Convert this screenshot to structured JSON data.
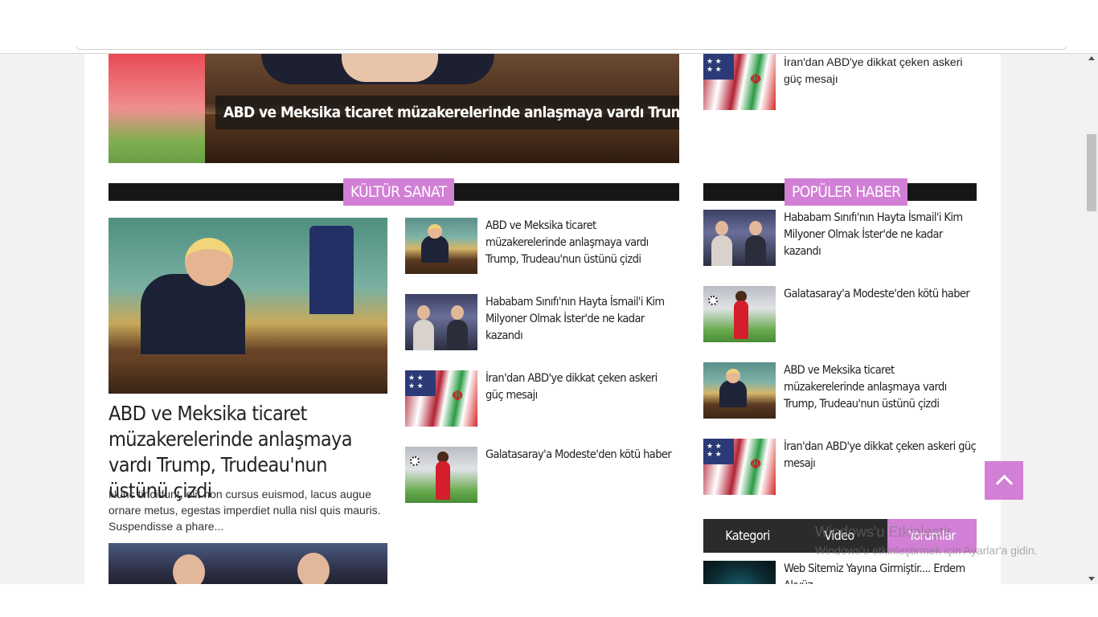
{
  "slider": {
    "caption": "ABD ve Meksika ticaret müzakerelerinde anlaşmaya vardı Trump, Trudeau'nun üstünü çizdi"
  },
  "right_top": {
    "title": "İran'dan ABD'ye dikkat çeken askeri güç mesajı"
  },
  "kultur": {
    "label": "KÜLTÜR SANAT",
    "featured": {
      "title": "ABD ve Meksika ticaret müzakerelerinde anlaşmaya vardı Trump, Trudeau'nun üstünü çizdi",
      "desc": "Nunc tincidunt, elit non cursus euismod, lacus augue ornare metus, egestas imperdiet nulla nisl quis mauris. Suspendisse a phare..."
    },
    "items": [
      {
        "title": "ABD ve Meksika ticaret müzakerelerinde anlaşmaya vardı Trump, Trudeau'nun üstünü çizdi"
      },
      {
        "title": "Hababam Sınıfı'nın Hayta İsmail'i Kim Milyoner Olmak İster'de ne kadar kazandı"
      },
      {
        "title": "İran'dan ABD'ye dikkat çeken askeri güç mesajı"
      },
      {
        "title": "Galatasaray'a Modeste'den kötü haber"
      }
    ]
  },
  "populer": {
    "label": "POPÜLER HABER",
    "items": [
      {
        "title": "Hababam Sınıfı'nın Hayta İsmail'i Kim Milyoner Olmak İster'de ne kadar kazandı"
      },
      {
        "title": "Galatasaray'a Modeste'den kötü haber"
      },
      {
        "title": "ABD ve Meksika ticaret müzakerelerinde anlaşmaya vardı Trump, Trudeau'nun üstünü çizdi"
      },
      {
        "title": "İran'dan ABD'ye dikkat çeken askeri güç mesajı"
      }
    ]
  },
  "tabs": {
    "items": [
      "Kategori",
      "Video",
      "Yorumlar"
    ],
    "active": "Yorumlar"
  },
  "tab_content": {
    "title": "Web Sitemiz Yayına Girmiştir.... Erdem Akyüz"
  },
  "watermark": {
    "line1": "Windows'u Etkinleştir",
    "line2": "Windows'u etkinleştirmek için Ayarlar'a gidin."
  },
  "icons": {
    "scroll_top": "chevron-up-icon"
  },
  "colors": {
    "accent": "#d27fd6",
    "section_bar": "#161616",
    "tab_bar": "#2b2b2b"
  }
}
